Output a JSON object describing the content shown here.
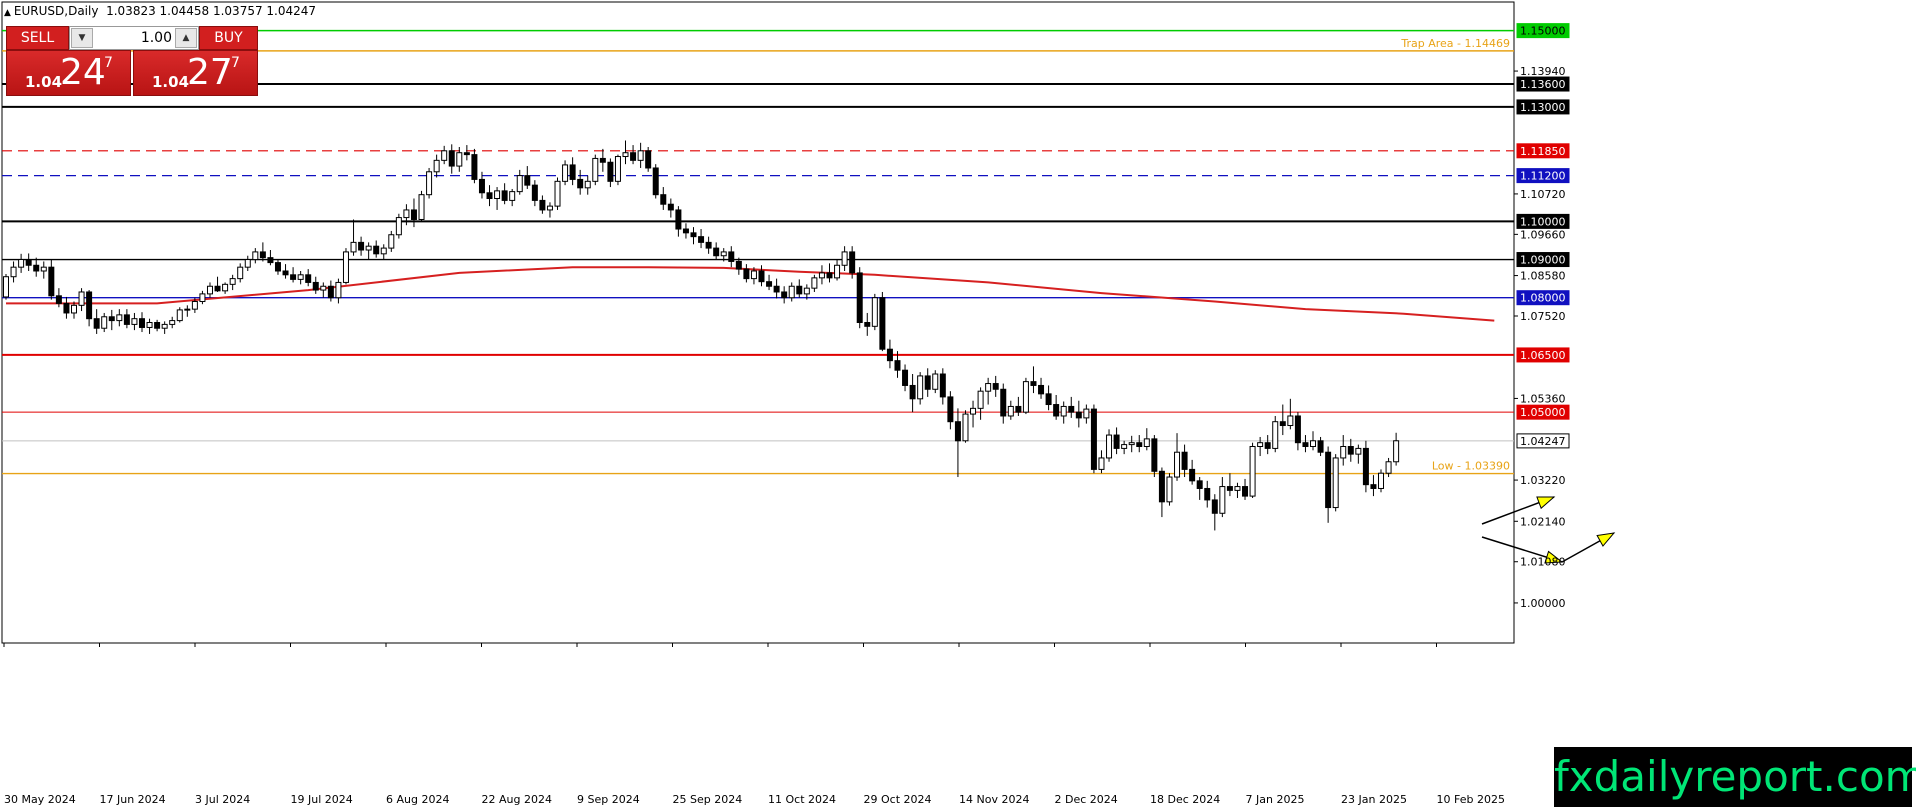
{
  "header": {
    "symbol": "EURUSD,Daily",
    "ohlc": "1.03823 1.04458 1.03757 1.04247"
  },
  "trade_panel": {
    "sell_label": "SELL",
    "buy_label": "BUY",
    "quantity": "1.00",
    "sell_small": "1.04",
    "sell_big": "24",
    "sell_sup": "7",
    "buy_small": "1.04",
    "buy_big": "27",
    "buy_sup": "7"
  },
  "watermark": "fxdailyreport.com",
  "colors": {
    "bull": "#ffffff",
    "bear": "#000000",
    "ma": "#d62020",
    "green": "#00cc00",
    "orange": "#e8a317",
    "red": "#e00000",
    "blue": "#1010c0",
    "arrow": "#ffff00"
  },
  "chart_data": {
    "type": "candlestick",
    "ylim": [
      0.9895,
      1.1575
    ],
    "y_ticks": [
      "1.13940",
      "1.10720",
      "1.09660",
      "1.08580",
      "1.07520",
      "1.05360",
      "1.03220",
      "1.02140",
      "1.01080",
      "1.00000"
    ],
    "x_tick_labels": [
      "30 May 2024",
      "17 Jun 2024",
      "3 Jul 2024",
      "19 Jul 2024",
      "6 Aug 2024",
      "22 Aug 2024",
      "9 Sep 2024",
      "25 Sep 2024",
      "11 Oct 2024",
      "29 Oct 2024",
      "14 Nov 2024",
      "2 Dec 2024",
      "18 Dec 2024",
      "7 Jan 2025",
      "23 Jan 2025",
      "10 Feb 2025"
    ],
    "levels": [
      {
        "value": 1.15,
        "label": "1.15000",
        "color": "#00cc00",
        "style": "solid",
        "tag_bg": "#00cc00",
        "tag_fg": "#000000"
      },
      {
        "value": 1.14469,
        "label": "Trap Area - 1.14469",
        "color": "#e8a317",
        "style": "solid",
        "text_label": true
      },
      {
        "value": 1.136,
        "label": "1.13600",
        "color": "#000000",
        "style": "solid-thick",
        "tag_bg": "#000000",
        "tag_fg": "#ffffff"
      },
      {
        "value": 1.13,
        "label": "1.13000",
        "color": "#000000",
        "style": "solid-thick",
        "tag_bg": "#000000",
        "tag_fg": "#ffffff"
      },
      {
        "value": 1.1185,
        "label": "1.11850",
        "color": "#e00000",
        "style": "dashed",
        "tag_bg": "#e00000",
        "tag_fg": "#ffffff"
      },
      {
        "value": 1.112,
        "label": "1.11200",
        "color": "#1010c0",
        "style": "dashed",
        "tag_bg": "#1010c0",
        "tag_fg": "#ffffff"
      },
      {
        "value": 1.1,
        "label": "1.10000",
        "color": "#000000",
        "style": "solid-thick",
        "tag_bg": "#000000",
        "tag_fg": "#ffffff"
      },
      {
        "value": 1.09,
        "label": "1.09000",
        "color": "#000000",
        "style": "solid",
        "tag_bg": "#000000",
        "tag_fg": "#ffffff"
      },
      {
        "value": 1.08,
        "label": "1.08000",
        "color": "#1010c0",
        "style": "solid",
        "tag_bg": "#1010c0",
        "tag_fg": "#ffffff"
      },
      {
        "value": 1.065,
        "label": "1.06500",
        "color": "#e00000",
        "style": "solid-thick",
        "tag_bg": "#e00000",
        "tag_fg": "#ffffff"
      },
      {
        "value": 1.05,
        "label": "1.05000",
        "color": "#e00000",
        "style": "solid-thin",
        "tag_bg": "#e00000",
        "tag_fg": "#ffffff"
      },
      {
        "value": 1.04247,
        "label": "1.04247",
        "color": "#c0c0c0",
        "style": "solid-thin",
        "tag_bg": "#ffffff",
        "tag_fg": "#000000",
        "tag_border": "#000000"
      },
      {
        "value": 1.0339,
        "label": "Low - 1.03390",
        "color": "#e8a317",
        "style": "solid",
        "text_label": true
      }
    ],
    "candles": [
      [
        1.0802,
        1.0862,
        1.0795,
        1.0855
      ],
      [
        1.0855,
        1.0895,
        1.084,
        1.088
      ],
      [
        1.088,
        1.0915,
        1.0865,
        1.09
      ],
      [
        1.09,
        1.0916,
        1.087,
        1.0885
      ],
      [
        1.0885,
        1.0905,
        1.0855,
        1.087
      ],
      [
        1.087,
        1.0895,
        1.085,
        1.088
      ],
      [
        1.088,
        1.09,
        1.0795,
        1.0805
      ],
      [
        1.0805,
        1.0825,
        1.0775,
        1.0785
      ],
      [
        1.0785,
        1.0802,
        1.0745,
        1.076
      ],
      [
        1.076,
        1.079,
        1.0745,
        1.078
      ],
      [
        1.078,
        1.0825,
        1.0765,
        1.0815
      ],
      [
        1.0815,
        1.082,
        1.0725,
        1.0745
      ],
      [
        1.0745,
        1.077,
        1.0705,
        1.072
      ],
      [
        1.072,
        1.076,
        1.071,
        1.075
      ],
      [
        1.075,
        1.0768,
        1.0715,
        1.074
      ],
      [
        1.074,
        1.077,
        1.0725,
        1.0755
      ],
      [
        1.0755,
        1.077,
        1.072,
        1.073
      ],
      [
        1.073,
        1.076,
        1.0715,
        1.0745
      ],
      [
        1.0745,
        1.0762,
        1.071,
        1.0722
      ],
      [
        1.0722,
        1.0745,
        1.0705,
        1.0735
      ],
      [
        1.0735,
        1.0742,
        1.0712,
        1.072
      ],
      [
        1.072,
        1.0738,
        1.0705,
        1.073
      ],
      [
        1.073,
        1.075,
        1.072,
        1.074
      ],
      [
        1.074,
        1.0775,
        1.0735,
        1.0768
      ],
      [
        1.0768,
        1.078,
        1.075,
        1.077
      ],
      [
        1.077,
        1.08,
        1.076,
        1.079
      ],
      [
        1.079,
        1.0818,
        1.0783,
        1.081
      ],
      [
        1.081,
        1.084,
        1.08,
        1.083
      ],
      [
        1.083,
        1.0855,
        1.0815,
        1.0818
      ],
      [
        1.0818,
        1.084,
        1.081,
        1.0835
      ],
      [
        1.0835,
        1.086,
        1.082,
        1.085
      ],
      [
        1.085,
        1.089,
        1.084,
        1.088
      ],
      [
        1.088,
        1.091,
        1.087,
        1.09
      ],
      [
        1.09,
        1.093,
        1.089,
        1.092
      ],
      [
        1.092,
        1.0945,
        1.0895,
        1.0905
      ],
      [
        1.0905,
        1.0925,
        1.0885,
        1.0892
      ],
      [
        1.0892,
        1.09,
        1.086,
        1.087
      ],
      [
        1.087,
        1.0888,
        1.085,
        1.086
      ],
      [
        1.086,
        1.088,
        1.084,
        1.0848
      ],
      [
        1.0848,
        1.087,
        1.0835,
        1.086
      ],
      [
        1.086,
        1.0875,
        1.083,
        1.084
      ],
      [
        1.084,
        1.0855,
        1.081,
        1.082
      ],
      [
        1.082,
        1.084,
        1.08,
        1.083
      ],
      [
        1.083,
        1.0845,
        1.079,
        1.08
      ],
      [
        1.08,
        1.085,
        1.0785,
        1.084
      ],
      [
        1.084,
        1.093,
        1.0835,
        1.092
      ],
      [
        1.092,
        1.1005,
        1.091,
        1.0945
      ],
      [
        1.0945,
        1.096,
        1.091,
        1.0925
      ],
      [
        1.0925,
        1.0945,
        1.09,
        1.0935
      ],
      [
        1.0935,
        1.095,
        1.0905,
        1.0915
      ],
      [
        1.0915,
        1.094,
        1.09,
        1.093
      ],
      [
        1.093,
        1.0975,
        1.092,
        1.0965
      ],
      [
        1.0965,
        1.102,
        1.0955,
        1.101
      ],
      [
        1.101,
        1.1045,
        1.099,
        1.103
      ],
      [
        1.103,
        1.106,
        1.0985,
        1.1005
      ],
      [
        1.1005,
        1.108,
        1.1,
        1.107
      ],
      [
        1.107,
        1.114,
        1.106,
        1.113
      ],
      [
        1.113,
        1.1175,
        1.1115,
        1.116
      ],
      [
        1.116,
        1.1198,
        1.115,
        1.1185
      ],
      [
        1.1185,
        1.1202,
        1.1125,
        1.1145
      ],
      [
        1.1145,
        1.1195,
        1.113,
        1.118
      ],
      [
        1.118,
        1.12,
        1.116,
        1.1175
      ],
      [
        1.1175,
        1.119,
        1.11,
        1.111
      ],
      [
        1.111,
        1.113,
        1.106,
        1.1075
      ],
      [
        1.1075,
        1.1095,
        1.104,
        1.106
      ],
      [
        1.106,
        1.109,
        1.103,
        1.108
      ],
      [
        1.108,
        1.11,
        1.1045,
        1.1055
      ],
      [
        1.1055,
        1.1085,
        1.104,
        1.1078
      ],
      [
        1.1078,
        1.1135,
        1.107,
        1.112
      ],
      [
        1.112,
        1.1145,
        1.1085,
        1.1095
      ],
      [
        1.1095,
        1.1108,
        1.104,
        1.1055
      ],
      [
        1.1055,
        1.1068,
        1.102,
        1.103
      ],
      [
        1.103,
        1.105,
        1.101,
        1.104
      ],
      [
        1.104,
        1.1115,
        1.103,
        1.1105
      ],
      [
        1.1105,
        1.116,
        1.1095,
        1.1148
      ],
      [
        1.1148,
        1.1168,
        1.1095,
        1.111
      ],
      [
        1.111,
        1.1135,
        1.107,
        1.1088
      ],
      [
        1.1088,
        1.112,
        1.107,
        1.1105
      ],
      [
        1.1105,
        1.1175,
        1.1095,
        1.1165
      ],
      [
        1.1165,
        1.119,
        1.113,
        1.1155
      ],
      [
        1.1155,
        1.1165,
        1.109,
        1.1105
      ],
      [
        1.1105,
        1.1175,
        1.1095,
        1.117
      ],
      [
        1.117,
        1.1212,
        1.115,
        1.118
      ],
      [
        1.118,
        1.12,
        1.115,
        1.116
      ],
      [
        1.116,
        1.1206,
        1.114,
        1.1185
      ],
      [
        1.1185,
        1.1195,
        1.113,
        1.114
      ],
      [
        1.114,
        1.115,
        1.106,
        1.107
      ],
      [
        1.107,
        1.109,
        1.103,
        1.1045
      ],
      [
        1.1045,
        1.106,
        1.101,
        1.103
      ],
      [
        1.103,
        1.104,
        1.096,
        1.098
      ],
      [
        1.098,
        1.0995,
        1.0955,
        1.097
      ],
      [
        1.097,
        1.0985,
        1.094,
        1.096
      ],
      [
        1.096,
        1.098,
        1.093,
        1.0945
      ],
      [
        1.0945,
        1.096,
        1.0915,
        1.093
      ],
      [
        1.093,
        1.0945,
        1.09,
        1.091
      ],
      [
        1.091,
        1.093,
        1.0895,
        1.092
      ],
      [
        1.092,
        1.0935,
        1.088,
        1.0895
      ],
      [
        1.0895,
        1.0905,
        1.086,
        1.0875
      ],
      [
        1.0875,
        1.0888,
        1.084,
        1.085
      ],
      [
        1.085,
        1.088,
        1.0835,
        1.087
      ],
      [
        1.087,
        1.0885,
        1.083,
        1.0842
      ],
      [
        1.0842,
        1.086,
        1.082,
        1.083
      ],
      [
        1.083,
        1.085,
        1.0798,
        1.0815
      ],
      [
        1.0815,
        1.083,
        1.0785,
        1.08
      ],
      [
        1.08,
        1.084,
        1.079,
        1.083
      ],
      [
        1.083,
        1.0848,
        1.08,
        1.081
      ],
      [
        1.081,
        1.0835,
        1.0795,
        1.0825
      ],
      [
        1.0825,
        1.086,
        1.0815,
        1.0852
      ],
      [
        1.0852,
        1.0885,
        1.0835,
        1.0865
      ],
      [
        1.0865,
        1.089,
        1.084,
        1.0852
      ],
      [
        1.0852,
        1.09,
        1.0845,
        1.0885
      ],
      [
        1.0885,
        1.0935,
        1.087,
        1.092
      ],
      [
        1.092,
        1.0935,
        1.085,
        1.0865
      ],
      [
        1.0865,
        1.088,
        1.072,
        1.0735
      ],
      [
        1.0735,
        1.076,
        1.07,
        1.0725
      ],
      [
        1.0725,
        1.081,
        1.0715,
        1.08
      ],
      [
        1.08,
        1.0815,
        1.066,
        1.0665
      ],
      [
        1.0665,
        1.069,
        1.0615,
        1.0635
      ],
      [
        1.0635,
        1.066,
        1.059,
        1.061
      ],
      [
        1.061,
        1.0625,
        1.0555,
        1.057
      ],
      [
        1.057,
        1.06,
        1.05,
        1.0535
      ],
      [
        1.0535,
        1.0605,
        1.052,
        1.0595
      ],
      [
        1.0595,
        1.0615,
        1.054,
        1.056
      ],
      [
        1.056,
        1.061,
        1.055,
        1.06
      ],
      [
        1.06,
        1.0615,
        1.052,
        1.054
      ],
      [
        1.054,
        1.0555,
        1.0455,
        1.0475
      ],
      [
        1.0475,
        1.051,
        1.033,
        1.0425
      ],
      [
        1.0425,
        1.0505,
        1.042,
        1.0495
      ],
      [
        1.0495,
        1.053,
        1.046,
        1.051
      ],
      [
        1.051,
        1.0565,
        1.048,
        1.0555
      ],
      [
        1.0555,
        1.059,
        1.052,
        1.0575
      ],
      [
        1.0575,
        1.0595,
        1.054,
        1.056
      ],
      [
        1.056,
        1.0575,
        1.047,
        1.049
      ],
      [
        1.049,
        1.053,
        1.048,
        1.0515
      ],
      [
        1.0515,
        1.054,
        1.049,
        1.05
      ],
      [
        1.05,
        1.059,
        1.0495,
        1.058
      ],
      [
        1.058,
        1.062,
        1.055,
        1.057
      ],
      [
        1.057,
        1.059,
        1.0535,
        1.0548
      ],
      [
        1.0548,
        1.057,
        1.0505,
        1.052
      ],
      [
        1.052,
        1.0545,
        1.048,
        1.049
      ],
      [
        1.049,
        1.0528,
        1.047,
        1.0515
      ],
      [
        1.0515,
        1.054,
        1.0485,
        1.05
      ],
      [
        1.05,
        1.053,
        1.046,
        1.0485
      ],
      [
        1.0485,
        1.052,
        1.047,
        1.0508
      ],
      [
        1.0508,
        1.052,
        1.034,
        1.035
      ],
      [
        1.035,
        1.04,
        1.034,
        1.038
      ],
      [
        1.038,
        1.0455,
        1.037,
        1.044
      ],
      [
        1.044,
        1.046,
        1.039,
        1.0405
      ],
      [
        1.0405,
        1.0425,
        1.039,
        1.0415
      ],
      [
        1.0415,
        1.0438,
        1.0395,
        1.042
      ],
      [
        1.042,
        1.044,
        1.0395,
        1.041
      ],
      [
        1.041,
        1.0458,
        1.04,
        1.043
      ],
      [
        1.043,
        1.044,
        1.033,
        1.0345
      ],
      [
        1.0345,
        1.0355,
        1.0225,
        1.0265
      ],
      [
        1.0265,
        1.034,
        1.0255,
        1.033
      ],
      [
        1.033,
        1.0445,
        1.032,
        1.0395
      ],
      [
        1.0395,
        1.0415,
        1.033,
        1.035
      ],
      [
        1.035,
        1.0375,
        1.031,
        1.032
      ],
      [
        1.032,
        1.033,
        1.027,
        1.03
      ],
      [
        1.03,
        1.032,
        1.025,
        1.027
      ],
      [
        1.027,
        1.0285,
        1.019,
        1.0235
      ],
      [
        1.0235,
        1.033,
        1.0225,
        1.0305
      ],
      [
        1.0305,
        1.034,
        1.028,
        1.0295
      ],
      [
        1.0295,
        1.0315,
        1.0275,
        1.0305
      ],
      [
        1.0305,
        1.0325,
        1.027,
        1.028
      ],
      [
        1.028,
        1.042,
        1.0275,
        1.041
      ],
      [
        1.041,
        1.0435,
        1.0385,
        1.042
      ],
      [
        1.042,
        1.044,
        1.039,
        1.0405
      ],
      [
        1.0405,
        1.049,
        1.0395,
        1.0475
      ],
      [
        1.0475,
        1.052,
        1.044,
        1.0465
      ],
      [
        1.0465,
        1.0535,
        1.0455,
        1.049
      ],
      [
        1.049,
        1.05,
        1.04,
        1.042
      ],
      [
        1.042,
        1.044,
        1.0395,
        1.041
      ],
      [
        1.041,
        1.045,
        1.04,
        1.0425
      ],
      [
        1.0425,
        1.0435,
        1.0385,
        1.0395
      ],
      [
        1.0395,
        1.041,
        1.021,
        1.025
      ],
      [
        1.025,
        1.039,
        1.024,
        1.038
      ],
      [
        1.038,
        1.044,
        1.036,
        1.041
      ],
      [
        1.041,
        1.043,
        1.037,
        1.039
      ],
      [
        1.039,
        1.0415,
        1.0365,
        1.0405
      ],
      [
        1.0405,
        1.0425,
        1.029,
        1.031
      ],
      [
        1.031,
        1.0335,
        1.028,
        1.03
      ],
      [
        1.03,
        1.035,
        1.029,
        1.034
      ],
      [
        1.034,
        1.038,
        1.033,
        1.037
      ],
      [
        1.037,
        1.0446,
        1.036,
        1.0425
      ]
    ],
    "ma_line": [
      [
        0,
        1.0785
      ],
      [
        20,
        1.0785
      ],
      [
        40,
        1.082
      ],
      [
        60,
        1.0865
      ],
      [
        75,
        1.088
      ],
      [
        85,
        1.088
      ],
      [
        95,
        1.0878
      ],
      [
        105,
        1.0868
      ],
      [
        115,
        1.086
      ],
      [
        130,
        1.084
      ],
      [
        145,
        1.0812
      ],
      [
        160,
        1.079
      ],
      [
        172,
        1.077
      ],
      [
        185,
        1.0758
      ],
      [
        197,
        1.074
      ]
    ]
  }
}
